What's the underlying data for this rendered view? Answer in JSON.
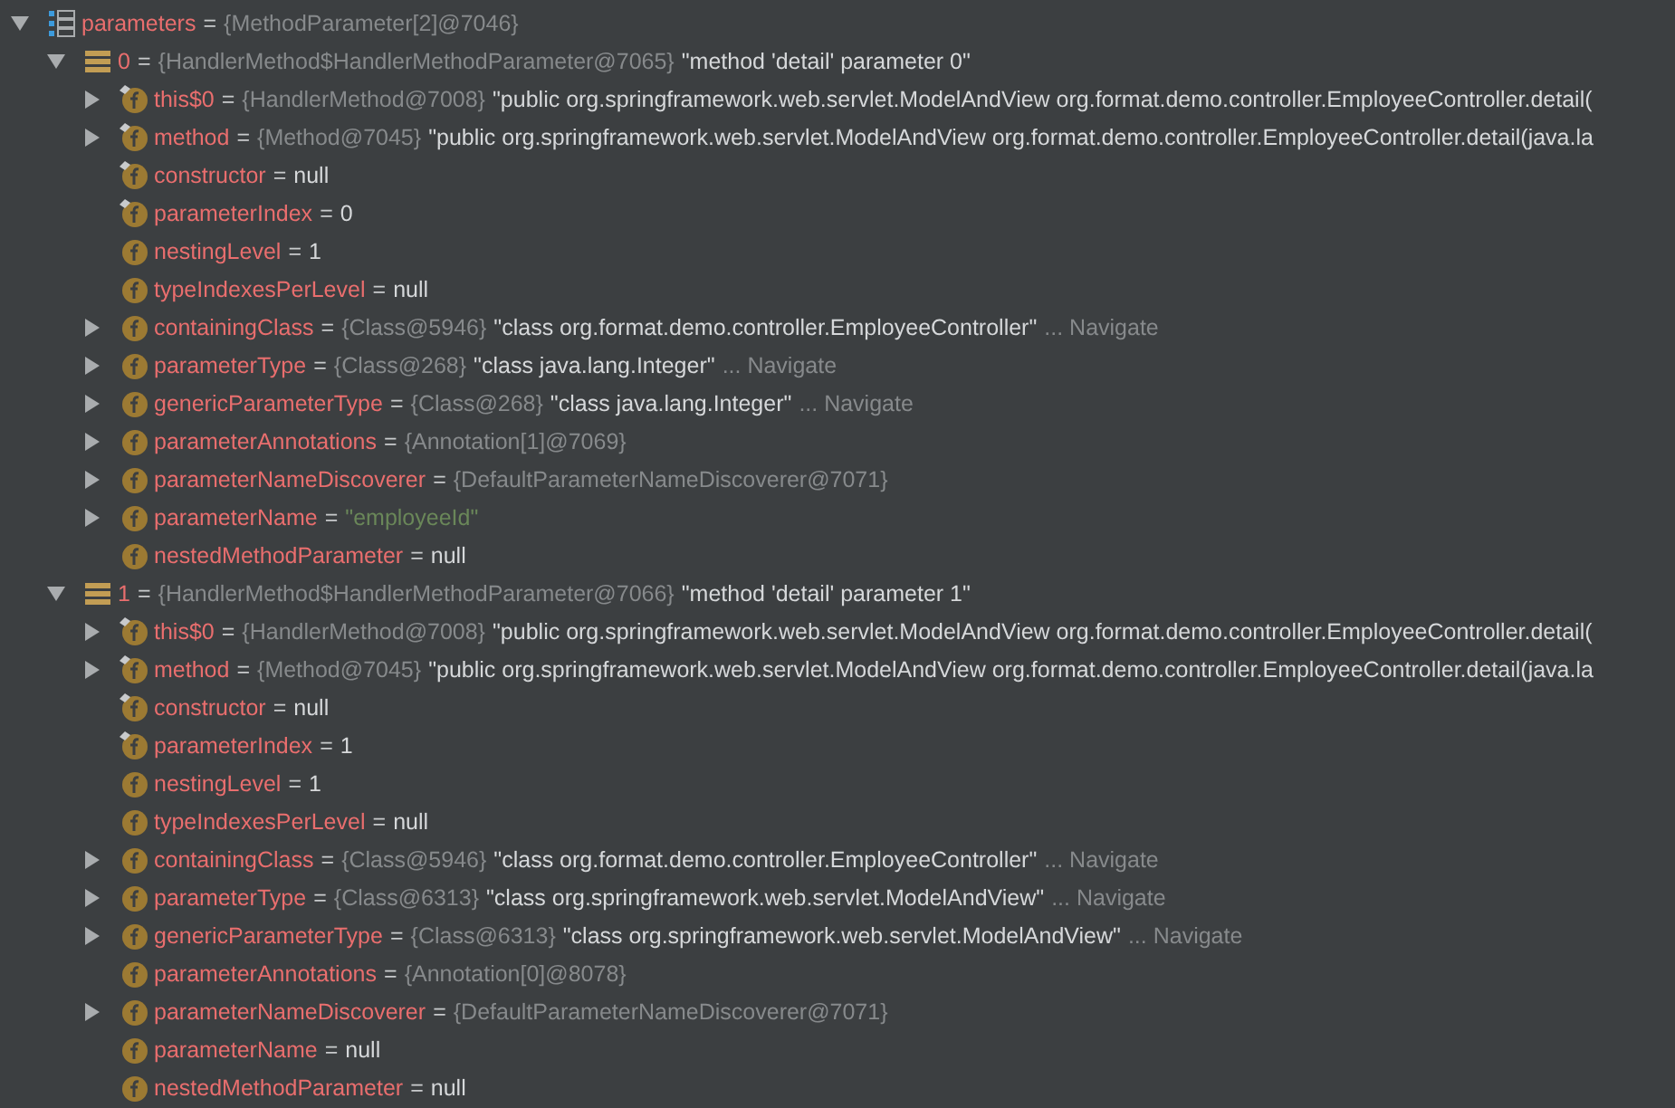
{
  "variables": [
    {
      "kind": "array",
      "name": "parameters",
      "eq": "=",
      "type": "{MethodParameter[2]@7046}",
      "expanded": true,
      "children": [
        {
          "kind": "object",
          "name": "0",
          "eq": "=",
          "type": "{HandlerMethod$HandlerMethodParameter@7065}",
          "value": "\"method 'detail' parameter 0\"",
          "is_string": false,
          "expanded": true,
          "children": [
            {
              "kind": "field",
              "final": true,
              "name": "this$0",
              "eq": "=",
              "type": "{HandlerMethod@7008}",
              "value": "\"public org.springframework.web.servlet.ModelAndView org.format.demo.controller.EmployeeController.detail(",
              "is_string": false,
              "expanded": false
            },
            {
              "kind": "field",
              "final": true,
              "name": "method",
              "eq": "=",
              "type": "{Method@7045}",
              "value": "\"public org.springframework.web.servlet.ModelAndView org.format.demo.controller.EmployeeController.detail(java.la",
              "is_string": false,
              "expanded": false
            },
            {
              "kind": "field",
              "final": true,
              "name": "constructor",
              "eq": "=",
              "value": "null",
              "is_string": false
            },
            {
              "kind": "field",
              "final": true,
              "name": "parameterIndex",
              "eq": "=",
              "value": "0",
              "is_string": false
            },
            {
              "kind": "field",
              "final": false,
              "name": "nestingLevel",
              "eq": "=",
              "value": "1",
              "is_string": false
            },
            {
              "kind": "field",
              "final": false,
              "name": "typeIndexesPerLevel",
              "eq": "=",
              "value": "null",
              "is_string": false
            },
            {
              "kind": "field",
              "final": false,
              "name": "containingClass",
              "eq": "=",
              "type": "{Class@5946}",
              "value": "\"class org.format.demo.controller.EmployeeController\"",
              "is_string": false,
              "link": "... Navigate",
              "expanded": false
            },
            {
              "kind": "field",
              "final": false,
              "name": "parameterType",
              "eq": "=",
              "type": "{Class@268}",
              "value": "\"class java.lang.Integer\"",
              "is_string": false,
              "link": "... Navigate",
              "expanded": false
            },
            {
              "kind": "field",
              "final": false,
              "name": "genericParameterType",
              "eq": "=",
              "type": "{Class@268}",
              "value": "\"class java.lang.Integer\"",
              "is_string": false,
              "link": "... Navigate",
              "expanded": false
            },
            {
              "kind": "field",
              "final": false,
              "name": "parameterAnnotations",
              "eq": "=",
              "type": "{Annotation[1]@7069}",
              "expanded": false
            },
            {
              "kind": "field",
              "final": false,
              "name": "parameterNameDiscoverer",
              "eq": "=",
              "type": "{DefaultParameterNameDiscoverer@7071}",
              "expanded": false
            },
            {
              "kind": "field",
              "final": false,
              "name": "parameterName",
              "eq": "=",
              "value": "\"employeeId\"",
              "is_string": true,
              "expanded": false
            },
            {
              "kind": "field",
              "final": false,
              "name": "nestedMethodParameter",
              "eq": "=",
              "value": "null",
              "is_string": false
            }
          ]
        },
        {
          "kind": "object",
          "name": "1",
          "eq": "=",
          "type": "{HandlerMethod$HandlerMethodParameter@7066}",
          "value": "\"method 'detail' parameter 1\"",
          "is_string": false,
          "expanded": true,
          "children": [
            {
              "kind": "field",
              "final": true,
              "name": "this$0",
              "eq": "=",
              "type": "{HandlerMethod@7008}",
              "value": "\"public org.springframework.web.servlet.ModelAndView org.format.demo.controller.EmployeeController.detail(",
              "is_string": false,
              "expanded": false
            },
            {
              "kind": "field",
              "final": true,
              "name": "method",
              "eq": "=",
              "type": "{Method@7045}",
              "value": "\"public org.springframework.web.servlet.ModelAndView org.format.demo.controller.EmployeeController.detail(java.la",
              "is_string": false,
              "expanded": false
            },
            {
              "kind": "field",
              "final": true,
              "name": "constructor",
              "eq": "=",
              "value": "null",
              "is_string": false
            },
            {
              "kind": "field",
              "final": true,
              "name": "parameterIndex",
              "eq": "=",
              "value": "1",
              "is_string": false
            },
            {
              "kind": "field",
              "final": false,
              "name": "nestingLevel",
              "eq": "=",
              "value": "1",
              "is_string": false
            },
            {
              "kind": "field",
              "final": false,
              "name": "typeIndexesPerLevel",
              "eq": "=",
              "value": "null",
              "is_string": false
            },
            {
              "kind": "field",
              "final": false,
              "name": "containingClass",
              "eq": "=",
              "type": "{Class@5946}",
              "value": "\"class org.format.demo.controller.EmployeeController\"",
              "is_string": false,
              "link": "... Navigate",
              "expanded": false
            },
            {
              "kind": "field",
              "final": false,
              "name": "parameterType",
              "eq": "=",
              "type": "{Class@6313}",
              "value": "\"class org.springframework.web.servlet.ModelAndView\"",
              "is_string": false,
              "link": "... Navigate",
              "expanded": false
            },
            {
              "kind": "field",
              "final": false,
              "name": "genericParameterType",
              "eq": "=",
              "type": "{Class@6313}",
              "value": "\"class org.springframework.web.servlet.ModelAndView\"",
              "is_string": false,
              "link": "... Navigate",
              "expanded": false
            },
            {
              "kind": "field",
              "final": false,
              "name": "parameterAnnotations",
              "eq": "=",
              "type": "{Annotation[0]@8078}"
            },
            {
              "kind": "field",
              "final": false,
              "name": "parameterNameDiscoverer",
              "eq": "=",
              "type": "{DefaultParameterNameDiscoverer@7071}",
              "expanded": false
            },
            {
              "kind": "field",
              "final": false,
              "name": "parameterName",
              "eq": "=",
              "value": "null",
              "is_string": false
            },
            {
              "kind": "field",
              "final": false,
              "name": "nestedMethodParameter",
              "eq": "=",
              "value": "null",
              "is_string": false
            }
          ]
        }
      ]
    }
  ]
}
